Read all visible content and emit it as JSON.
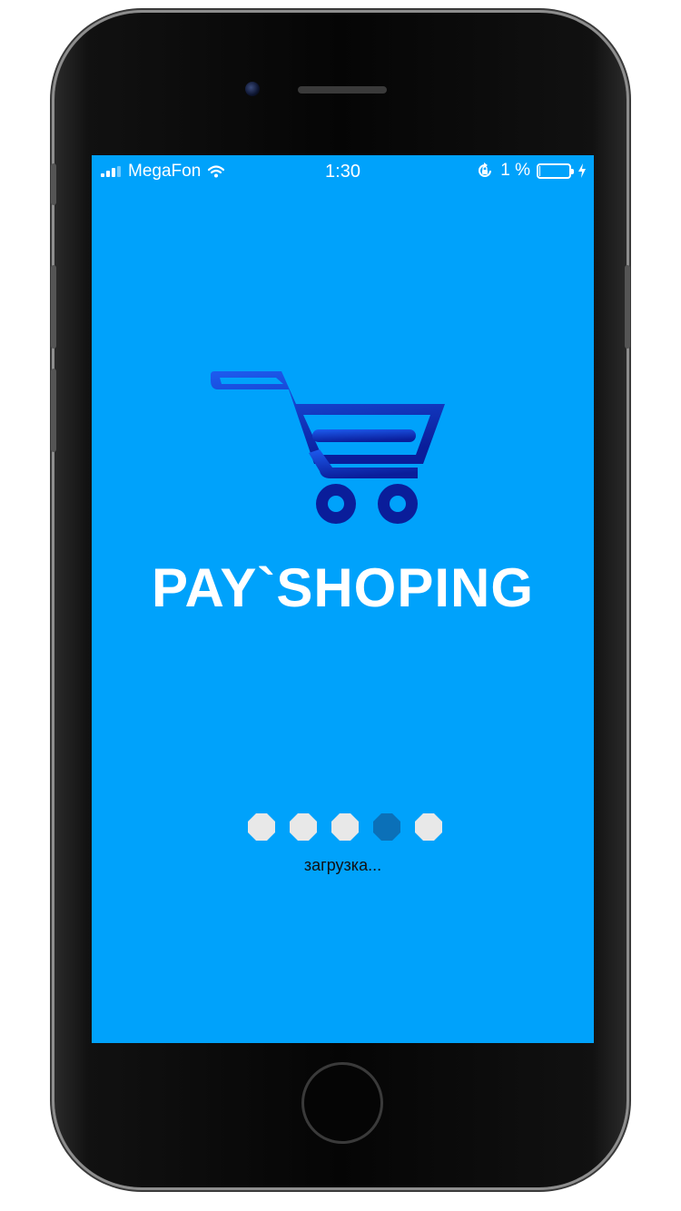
{
  "status_bar": {
    "carrier": "MegaFon",
    "time": "1:30",
    "battery_percent_text": "1 %",
    "battery_level": 0.01,
    "icons": [
      "signal-icon",
      "wifi-icon",
      "rotation-lock-icon",
      "battery-icon",
      "charging-bolt-icon"
    ]
  },
  "app": {
    "logo_icon": "shopping-cart-icon",
    "title": "PAY`SHOPING"
  },
  "loader": {
    "dots": [
      {
        "active": false
      },
      {
        "active": false
      },
      {
        "active": false
      },
      {
        "active": true
      },
      {
        "active": false
      }
    ],
    "text": "загрузка..."
  },
  "colors": {
    "screen_background": "#00a2fb",
    "cart_gradient_start": "#1d5cf0",
    "cart_gradient_end": "#0a1d9a",
    "dot_inactive": "#e8e8e8",
    "dot_active": "#0b70b8"
  }
}
